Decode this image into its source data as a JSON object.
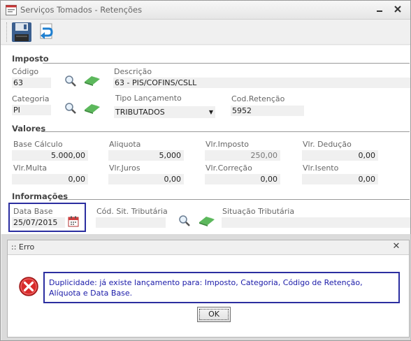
{
  "window": {
    "title": "Serviços Tomados - Retenções",
    "controls": [
      "minimize",
      "maximize",
      "close"
    ]
  },
  "toolbar": {
    "buttons": [
      {
        "name": "save",
        "icon": "floppy-disk-icon"
      },
      {
        "name": "undo",
        "icon": "return-arrow-icon"
      }
    ]
  },
  "imposto": {
    "section_title": "Imposto",
    "codigo": {
      "label": "Código",
      "value": "63"
    },
    "descricao": {
      "label": "Descrição",
      "value": "63 - PIS/COFINS/CSLL"
    },
    "categoria": {
      "label": "Categoria",
      "value": "PI"
    },
    "tipo_lancamento": {
      "label": "Tipo Lançamento",
      "value": "TRIBUTADOS"
    },
    "cod_retencao": {
      "label": "Cod.Retenção",
      "value": "5952"
    }
  },
  "valores": {
    "section_title": "Valores",
    "base_calculo": {
      "label": "Base Cálculo",
      "value": "5.000,00"
    },
    "aliquota": {
      "label": "Aliquota",
      "value": "5,000"
    },
    "vlr_imposto": {
      "label": "Vlr.Imposto",
      "value": "250,00"
    },
    "vlr_deducao": {
      "label": "Vlr. Dedução",
      "value": "0,00"
    },
    "vlr_multa": {
      "label": "Vlr.Multa",
      "value": "0,00"
    },
    "vlr_juros": {
      "label": "Vlr.Juros",
      "value": "0,00"
    },
    "vlr_correcao": {
      "label": "Vlr.Correção",
      "value": "0,00"
    },
    "vlr_isento": {
      "label": "Vlr.Isento",
      "value": "0,00"
    }
  },
  "informacoes": {
    "section_title": "Informações",
    "data_base": {
      "label": "Data Base",
      "value": "25/07/2015"
    },
    "cod_sit_tributaria": {
      "label": "Cód. Sit. Tributária",
      "value": ""
    },
    "situacao_tributaria": {
      "label": "Situação Tributária",
      "value": ""
    }
  },
  "dialog": {
    "title": ":: Erro",
    "close_label": "✕",
    "message": "Duplicidade: já existe lançamento para: Imposto, Categoria, Código de Retenção, Alíquota e Data Base.",
    "ok_label": "OK"
  },
  "colors": {
    "highlight_border": "#2b2ea0",
    "message_text": "#1a1aa8",
    "field_bg": "#f0f0f0"
  }
}
